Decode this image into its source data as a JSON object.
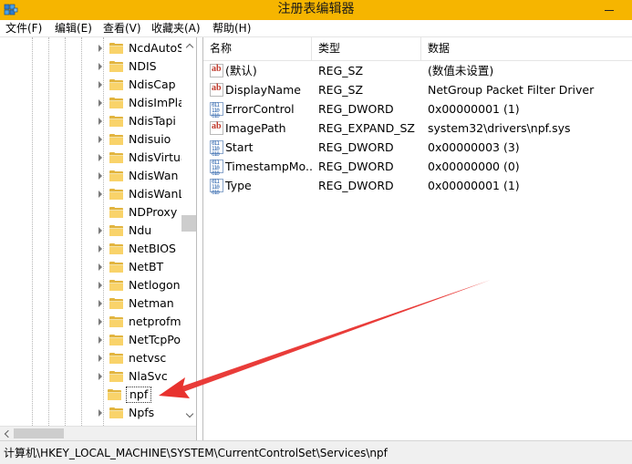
{
  "window": {
    "title": "注册表编辑器"
  },
  "menu": [
    {
      "label": "文件(F)"
    },
    {
      "label": "编辑(E)"
    },
    {
      "label": "查看(V)"
    },
    {
      "label": "收藏夹(A)"
    },
    {
      "label": "帮助(H)"
    }
  ],
  "tree": {
    "items": [
      {
        "label": "NcdAutoS",
        "has_children": true
      },
      {
        "label": "NDIS",
        "has_children": true
      },
      {
        "label": "NdisCap",
        "has_children": true
      },
      {
        "label": "NdisImPla",
        "has_children": true
      },
      {
        "label": "NdisTapi",
        "has_children": true
      },
      {
        "label": "Ndisuio",
        "has_children": true
      },
      {
        "label": "NdisVirtua",
        "has_children": true
      },
      {
        "label": "NdisWan",
        "has_children": true
      },
      {
        "label": "NdisWanL",
        "has_children": true
      },
      {
        "label": "NDProxy",
        "has_children": false
      },
      {
        "label": "Ndu",
        "has_children": true
      },
      {
        "label": "NetBIOS",
        "has_children": true
      },
      {
        "label": "NetBT",
        "has_children": true
      },
      {
        "label": "Netlogon",
        "has_children": true
      },
      {
        "label": "Netman",
        "has_children": true
      },
      {
        "label": "netprofm",
        "has_children": true
      },
      {
        "label": "NetTcpPo",
        "has_children": true
      },
      {
        "label": "netvsc",
        "has_children": true
      },
      {
        "label": "NlaSvc",
        "has_children": true
      },
      {
        "label": "npf",
        "has_children": false,
        "selected": true
      },
      {
        "label": "Npfs",
        "has_children": true
      }
    ]
  },
  "values": {
    "columns": {
      "name": "名称",
      "type": "类型",
      "data": "数据"
    },
    "rows": [
      {
        "name": "(默认)",
        "type": "REG_SZ",
        "data": "(数值未设置)",
        "icon": "string-value-icon"
      },
      {
        "name": "DisplayName",
        "type": "REG_SZ",
        "data": "NetGroup Packet Filter Driver",
        "icon": "string-value-icon"
      },
      {
        "name": "ErrorControl",
        "type": "REG_DWORD",
        "data": "0x00000001 (1)",
        "icon": "binary-value-icon"
      },
      {
        "name": "ImagePath",
        "type": "REG_EXPAND_SZ",
        "data": "system32\\drivers\\npf.sys",
        "icon": "string-value-icon"
      },
      {
        "name": "Start",
        "type": "REG_DWORD",
        "data": "0x00000003 (3)",
        "icon": "binary-value-icon"
      },
      {
        "name": "TimestampMo...",
        "type": "REG_DWORD",
        "data": "0x00000000 (0)",
        "icon": "binary-value-icon"
      },
      {
        "name": "Type",
        "type": "REG_DWORD",
        "data": "0x00000001 (1)",
        "icon": "binary-value-icon"
      }
    ]
  },
  "status": {
    "path": "计算机\\HKEY_LOCAL_MACHINE\\SYSTEM\\CurrentControlSet\\Services\\npf"
  },
  "colors": {
    "titlebar": "#f6b500",
    "annotation_arrow": "#e8322e"
  }
}
